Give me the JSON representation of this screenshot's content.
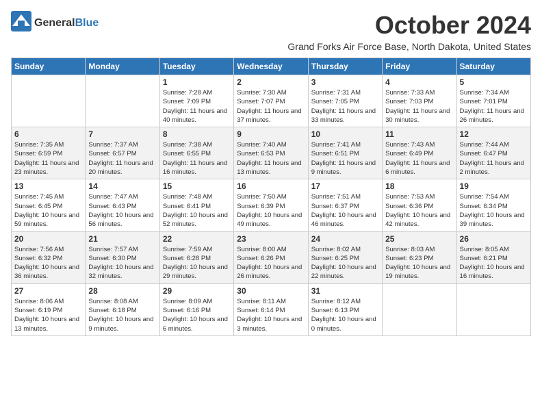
{
  "logo": {
    "text_general": "General",
    "text_blue": "Blue"
  },
  "title": "October 2024",
  "subtitle": "Grand Forks Air Force Base, North Dakota, United States",
  "headers": [
    "Sunday",
    "Monday",
    "Tuesday",
    "Wednesday",
    "Thursday",
    "Friday",
    "Saturday"
  ],
  "weeks": [
    [
      {
        "day": "",
        "info": ""
      },
      {
        "day": "",
        "info": ""
      },
      {
        "day": "1",
        "info": "Sunrise: 7:28 AM\nSunset: 7:09 PM\nDaylight: 11 hours and 40 minutes."
      },
      {
        "day": "2",
        "info": "Sunrise: 7:30 AM\nSunset: 7:07 PM\nDaylight: 11 hours and 37 minutes."
      },
      {
        "day": "3",
        "info": "Sunrise: 7:31 AM\nSunset: 7:05 PM\nDaylight: 11 hours and 33 minutes."
      },
      {
        "day": "4",
        "info": "Sunrise: 7:33 AM\nSunset: 7:03 PM\nDaylight: 11 hours and 30 minutes."
      },
      {
        "day": "5",
        "info": "Sunrise: 7:34 AM\nSunset: 7:01 PM\nDaylight: 11 hours and 26 minutes."
      }
    ],
    [
      {
        "day": "6",
        "info": "Sunrise: 7:35 AM\nSunset: 6:59 PM\nDaylight: 11 hours and 23 minutes."
      },
      {
        "day": "7",
        "info": "Sunrise: 7:37 AM\nSunset: 6:57 PM\nDaylight: 11 hours and 20 minutes."
      },
      {
        "day": "8",
        "info": "Sunrise: 7:38 AM\nSunset: 6:55 PM\nDaylight: 11 hours and 16 minutes."
      },
      {
        "day": "9",
        "info": "Sunrise: 7:40 AM\nSunset: 6:53 PM\nDaylight: 11 hours and 13 minutes."
      },
      {
        "day": "10",
        "info": "Sunrise: 7:41 AM\nSunset: 6:51 PM\nDaylight: 11 hours and 9 minutes."
      },
      {
        "day": "11",
        "info": "Sunrise: 7:43 AM\nSunset: 6:49 PM\nDaylight: 11 hours and 6 minutes."
      },
      {
        "day": "12",
        "info": "Sunrise: 7:44 AM\nSunset: 6:47 PM\nDaylight: 11 hours and 2 minutes."
      }
    ],
    [
      {
        "day": "13",
        "info": "Sunrise: 7:45 AM\nSunset: 6:45 PM\nDaylight: 10 hours and 59 minutes."
      },
      {
        "day": "14",
        "info": "Sunrise: 7:47 AM\nSunset: 6:43 PM\nDaylight: 10 hours and 56 minutes."
      },
      {
        "day": "15",
        "info": "Sunrise: 7:48 AM\nSunset: 6:41 PM\nDaylight: 10 hours and 52 minutes."
      },
      {
        "day": "16",
        "info": "Sunrise: 7:50 AM\nSunset: 6:39 PM\nDaylight: 10 hours and 49 minutes."
      },
      {
        "day": "17",
        "info": "Sunrise: 7:51 AM\nSunset: 6:37 PM\nDaylight: 10 hours and 46 minutes."
      },
      {
        "day": "18",
        "info": "Sunrise: 7:53 AM\nSunset: 6:36 PM\nDaylight: 10 hours and 42 minutes."
      },
      {
        "day": "19",
        "info": "Sunrise: 7:54 AM\nSunset: 6:34 PM\nDaylight: 10 hours and 39 minutes."
      }
    ],
    [
      {
        "day": "20",
        "info": "Sunrise: 7:56 AM\nSunset: 6:32 PM\nDaylight: 10 hours and 36 minutes."
      },
      {
        "day": "21",
        "info": "Sunrise: 7:57 AM\nSunset: 6:30 PM\nDaylight: 10 hours and 32 minutes."
      },
      {
        "day": "22",
        "info": "Sunrise: 7:59 AM\nSunset: 6:28 PM\nDaylight: 10 hours and 29 minutes."
      },
      {
        "day": "23",
        "info": "Sunrise: 8:00 AM\nSunset: 6:26 PM\nDaylight: 10 hours and 26 minutes."
      },
      {
        "day": "24",
        "info": "Sunrise: 8:02 AM\nSunset: 6:25 PM\nDaylight: 10 hours and 22 minutes."
      },
      {
        "day": "25",
        "info": "Sunrise: 8:03 AM\nSunset: 6:23 PM\nDaylight: 10 hours and 19 minutes."
      },
      {
        "day": "26",
        "info": "Sunrise: 8:05 AM\nSunset: 6:21 PM\nDaylight: 10 hours and 16 minutes."
      }
    ],
    [
      {
        "day": "27",
        "info": "Sunrise: 8:06 AM\nSunset: 6:19 PM\nDaylight: 10 hours and 13 minutes."
      },
      {
        "day": "28",
        "info": "Sunrise: 8:08 AM\nSunset: 6:18 PM\nDaylight: 10 hours and 9 minutes."
      },
      {
        "day": "29",
        "info": "Sunrise: 8:09 AM\nSunset: 6:16 PM\nDaylight: 10 hours and 6 minutes."
      },
      {
        "day": "30",
        "info": "Sunrise: 8:11 AM\nSunset: 6:14 PM\nDaylight: 10 hours and 3 minutes."
      },
      {
        "day": "31",
        "info": "Sunrise: 8:12 AM\nSunset: 6:13 PM\nDaylight: 10 hours and 0 minutes."
      },
      {
        "day": "",
        "info": ""
      },
      {
        "day": "",
        "info": ""
      }
    ]
  ]
}
